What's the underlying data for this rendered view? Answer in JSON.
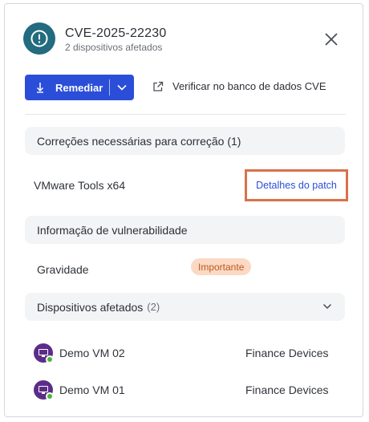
{
  "header": {
    "title": "CVE-2025-22230",
    "subtitle": "2 dispositivos afetados"
  },
  "actions": {
    "remediate_label": "Remediar",
    "verify_link": "Verificar no banco de dados CVE"
  },
  "fixes": {
    "heading": "Correções necessárias para correção (1)",
    "items": [
      {
        "name": "VMware Tools x64",
        "link": "Detalhes do patch"
      }
    ]
  },
  "vulnerability": {
    "heading": "Informação de vulnerabilidade",
    "severity_label": "Gravidade",
    "severity_value": "Importante"
  },
  "devices": {
    "heading": "Dispositivos afetados",
    "count": "(2)",
    "items": [
      {
        "name": "Demo VM 02",
        "group": "Finance Devices"
      },
      {
        "name": "Demo VM 01",
        "group": "Finance Devices"
      }
    ]
  },
  "colors": {
    "accent": "#2b4ed9",
    "header_icon_bg": "#226b80",
    "badge_bg": "#fbd9c4",
    "badge_text": "#bc5a1f",
    "highlight_border": "#d9714a",
    "device_icon": "#5b2d88",
    "online_status": "#4cb43c"
  }
}
